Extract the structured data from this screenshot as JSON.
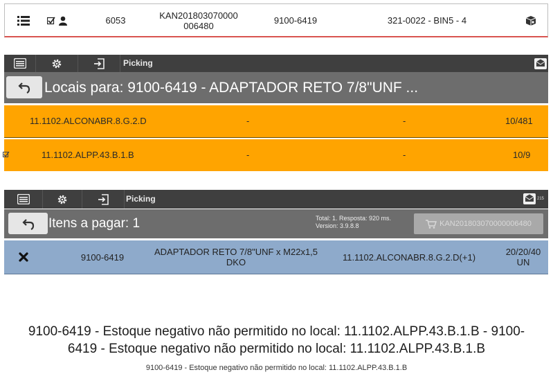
{
  "top_row": {
    "number": "6053",
    "kanban": "KAN201803070000006480",
    "kanban_line1": "KAN201803070000",
    "kanban_line2": "006480",
    "item_code": "9100-6419",
    "bin": "321-0022 - BIN5 - 4"
  },
  "toolbar": {
    "title": "Picking",
    "mail_badge": "215",
    "icons": [
      "list-icon",
      "gear-icon",
      "logout-icon",
      "mail-icon"
    ]
  },
  "locations_panel": {
    "title": "Locais para: 9100-6419 - ADAPTADOR RETO 7/8\"UNF ...",
    "rows": [
      {
        "location": "11.1102.ALCONABR.8.G.2.D",
        "col2": "-",
        "col3": "-",
        "qty": "10/481",
        "checked": false
      },
      {
        "location": "11.1102.ALPP.43.B.1.B",
        "col2": "-",
        "col3": "-",
        "qty": "10/9",
        "checked": true
      }
    ]
  },
  "items_panel": {
    "title": "Itens a pagar: 1",
    "stats_line1": "Total: 1. Resposta: 920 ms.",
    "stats_line2": "Version: 3.9.8.8",
    "kanban_button": "KAN201803070000006480",
    "row": {
      "code": "9100-6419",
      "description_line1": "ADAPTADOR RETO 7/8\"UNF x M22x1,5",
      "description_line2": "DKO",
      "location": "11.1102.ALCONABR.8.G.2.D(+1)",
      "qty_line1": "20/20/40",
      "qty_line2": "UN"
    }
  },
  "messages": {
    "big_line1": "9100-6419 - Estoque negativo não permitido no local: 11.1102.ALPP.43.B.1.B - 9100-",
    "big_line2": "6419 - Estoque negativo não permitido no local: 11.1102.ALPP.43.B.1.B",
    "small": "9100-6419 - Estoque negativo não permitido no local: 11.1102.ALPP.43.B.1.B"
  },
  "colors": {
    "toolbar_bg": "#3f3f3f",
    "header_bg": "#6d6d6d",
    "location_row": "#ffa400",
    "item_row": "#8eaacb"
  }
}
